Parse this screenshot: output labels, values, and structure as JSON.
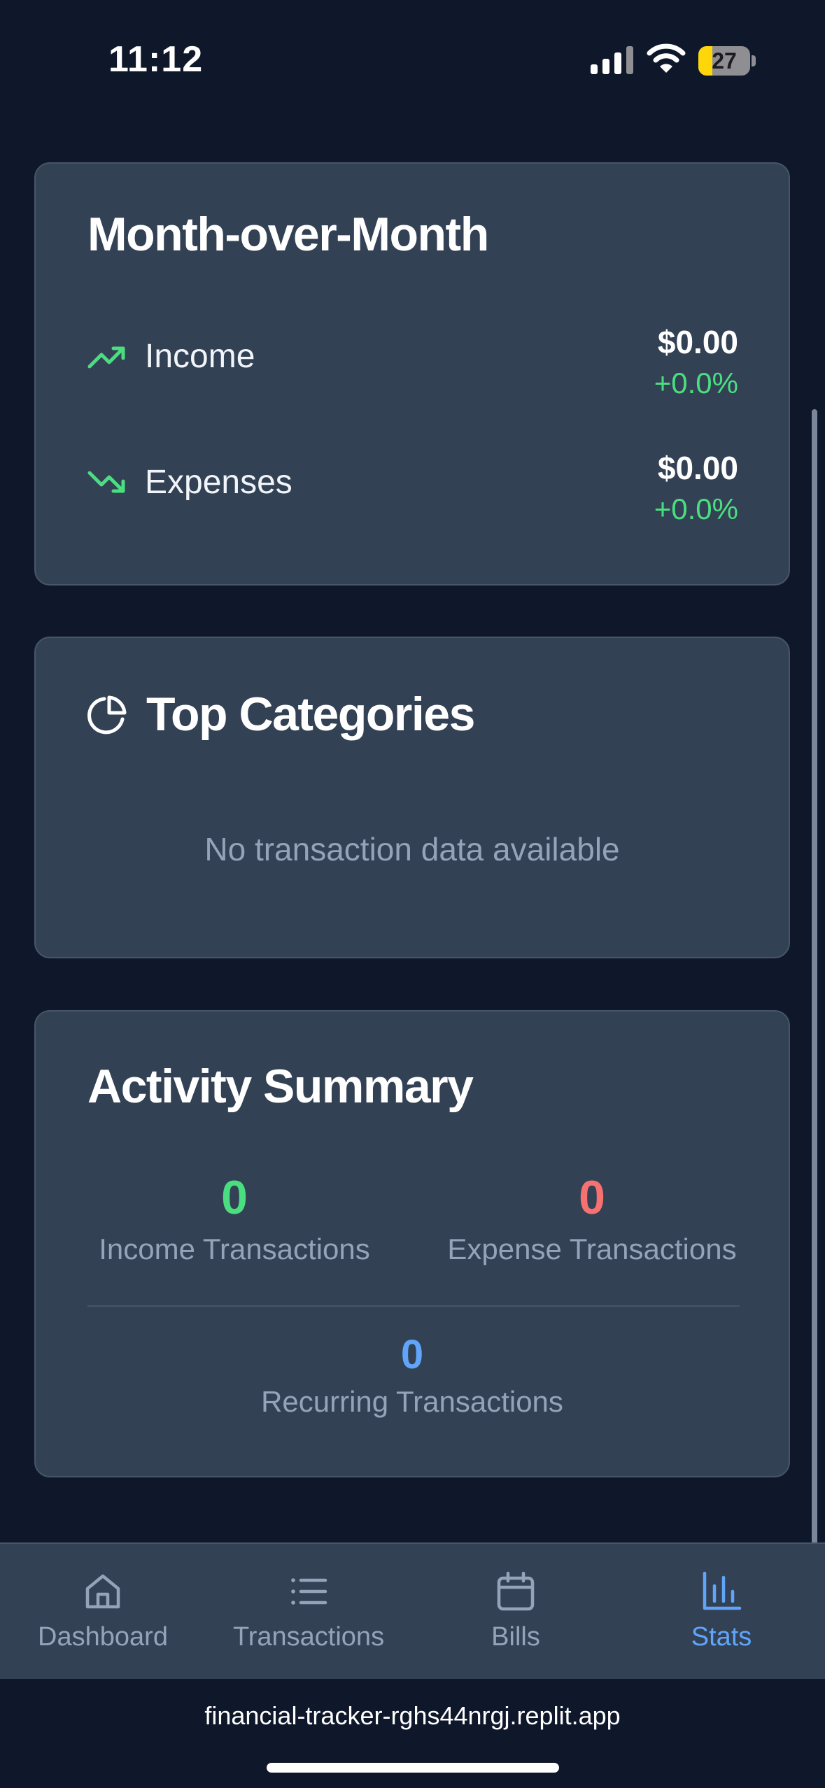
{
  "status_bar": {
    "time": "11:12",
    "battery_level": "27",
    "battery_fraction": 0.27
  },
  "month_over_month": {
    "title": "Month-over-Month",
    "rows": [
      {
        "label": "Income",
        "amount": "$0.00",
        "change": "+0.0%",
        "icon": "trending-up-icon"
      },
      {
        "label": "Expenses",
        "amount": "$0.00",
        "change": "+0.0%",
        "icon": "trending-down-icon"
      }
    ],
    "accent_color": "#4ade80"
  },
  "top_categories": {
    "title": "Top Categories",
    "icon": "pie-chart-icon",
    "empty_message": "No transaction data available"
  },
  "activity_summary": {
    "title": "Activity Summary",
    "income": {
      "value": "0",
      "label": "Income Transactions",
      "color": "#4ade80"
    },
    "expense": {
      "value": "0",
      "label": "Expense Transactions",
      "color": "#f87171"
    },
    "recurring": {
      "value": "0",
      "label": "Recurring Transactions",
      "color": "#60a5fa"
    }
  },
  "nav": {
    "items": [
      {
        "label": "Dashboard",
        "icon": "home-icon"
      },
      {
        "label": "Transactions",
        "icon": "list-icon"
      },
      {
        "label": "Bills",
        "icon": "calendar-icon"
      },
      {
        "label": "Stats",
        "icon": "bar-chart-icon",
        "active": true
      }
    ],
    "active_color": "#60a5fa"
  },
  "browser": {
    "url": "financial-tracker-rghs44nrgj.replit.app"
  }
}
